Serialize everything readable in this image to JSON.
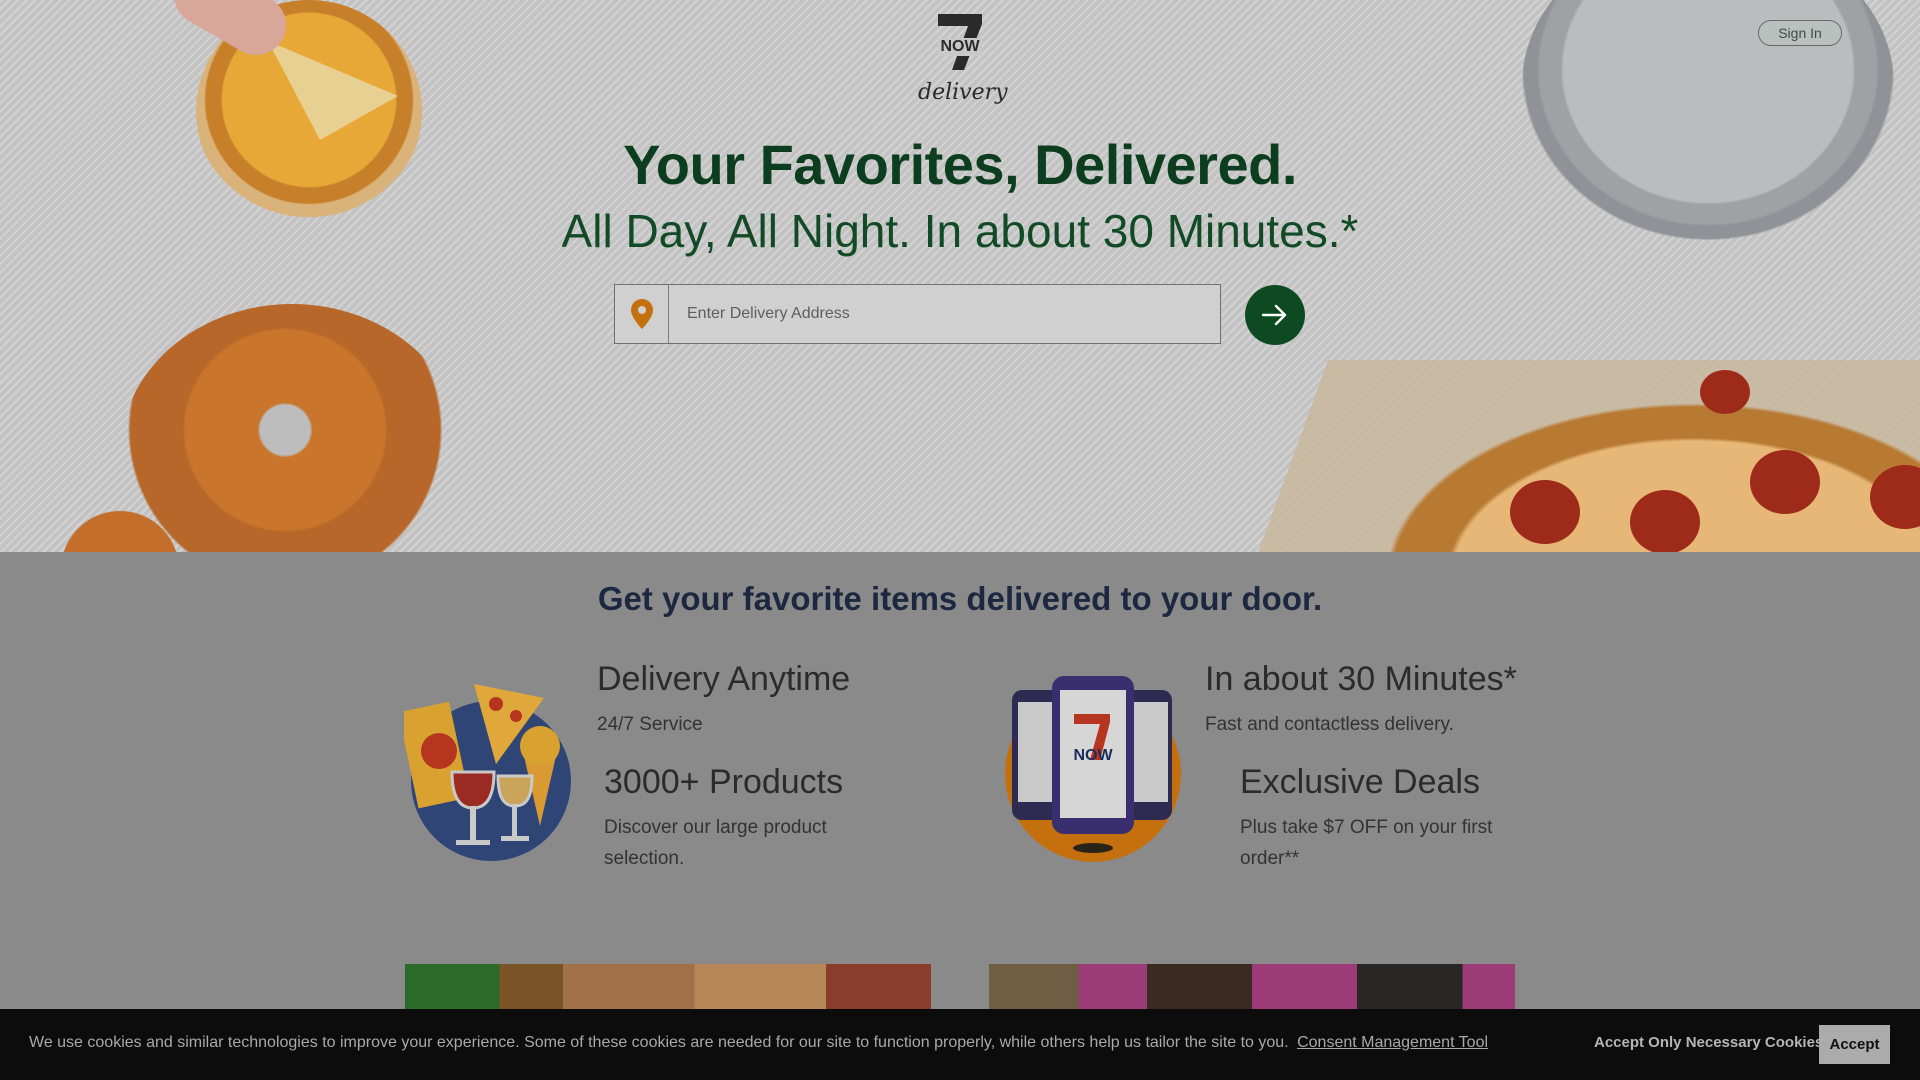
{
  "header": {
    "logo_now": "NOW",
    "logo_delivery": "delivery",
    "signin_label": "Sign In"
  },
  "hero": {
    "headline": "Your Favorites, Delivered.",
    "subheadline": "All Day, All Night. In about 30 Minutes.*",
    "address_placeholder": "Enter Delivery Address",
    "address_value": "",
    "pin_icon": "location-pin-icon",
    "go_icon": "arrow-right-icon"
  },
  "features": {
    "section_title": "Get your favorite items delivered to your door.",
    "items": [
      {
        "title": "Delivery Anytime",
        "desc": "24/7 Service"
      },
      {
        "title": "3000+ Products",
        "desc": "Discover our large product selection."
      },
      {
        "title": "In about 30 Minutes*",
        "desc": "Fast and contactless delivery."
      },
      {
        "title": "Exclusive Deals",
        "desc": "Plus take $7 OFF on your first order**"
      }
    ],
    "phone_logo_text": "NOW"
  },
  "cookie": {
    "text": "We use cookies and similar technologies to improve your experience. Some of these cookies are needed for our site to function properly, while others help us tailor the site to you.",
    "link_label": "Consent Management Tool",
    "necessary_label": "Accept Only Necessary Cookies",
    "accept_label": "Accept"
  },
  "colors": {
    "brand_green": "#0c3d1e",
    "pin_orange": "#c5700f",
    "navy": "#1c2740"
  }
}
